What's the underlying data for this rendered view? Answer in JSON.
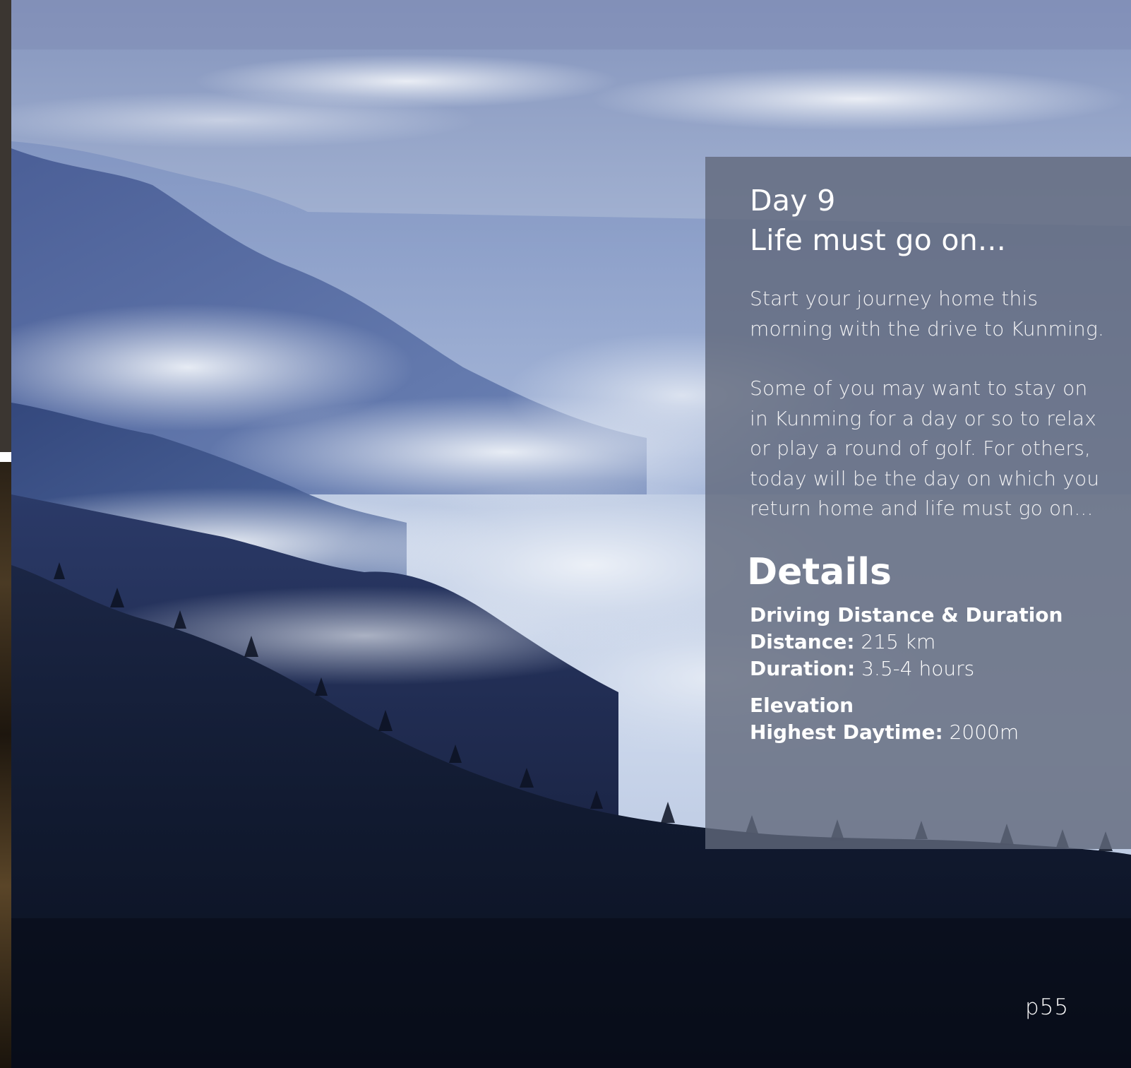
{
  "panel": {
    "day_title": "Day 9",
    "day_subtitle": "Life must go on...",
    "paragraphs": [
      "Start your journey home this morning with the drive to Kunming.",
      "Some of you may want to stay on in Kunming for a day or so to relax or play a round of golf. For others, today will be the day on which you return home and life must go on..."
    ],
    "details_heading": "Details",
    "driving": {
      "heading": "Driving Distance & Duration",
      "distance_label": "Distance:",
      "distance_value": "215 km",
      "duration_label": "Duration:",
      "duration_value": "3.5-4 hours"
    },
    "elevation": {
      "heading": "Elevation",
      "highest_label": "Highest Daytime:",
      "highest_value": "2000m"
    }
  },
  "page_number": "p55",
  "colors": {
    "panel_overlay": "#60687a",
    "sky": "#aebdd8",
    "mist": "#dfe6f2",
    "far_ridge": "#6f86b8",
    "mid_ridge": "#4a629a",
    "near_ridge": "#2a3a66",
    "forest": "#0f1626"
  }
}
